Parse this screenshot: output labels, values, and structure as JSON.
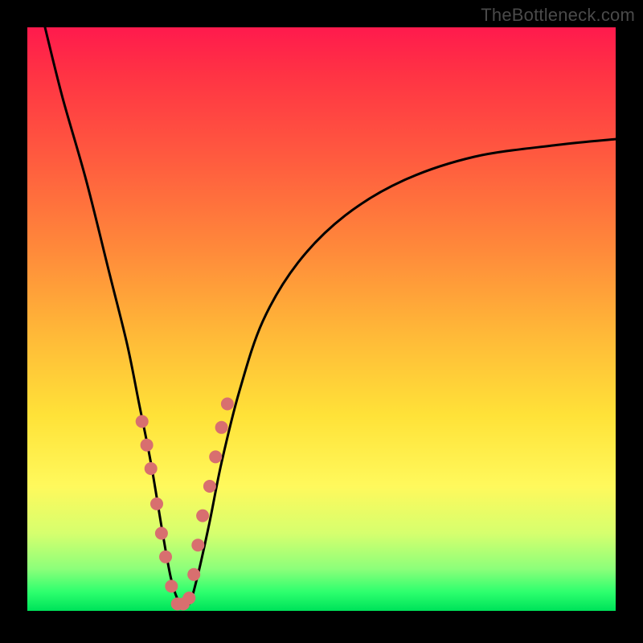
{
  "watermark_text": "TheBottleneck.com",
  "colors": {
    "frame": "#000000",
    "curve_stroke": "#000000",
    "dot_fill": "#d86f6f",
    "gradient_top": "#ff1a4d",
    "gradient_mid_orange": "#ff8a3a",
    "gradient_mid_yellow": "#ffe238",
    "gradient_green": "#00e45a"
  },
  "chart_data": {
    "type": "line",
    "title": "",
    "xlabel": "",
    "ylabel": "",
    "xlim": [
      0,
      100
    ],
    "ylim": [
      0,
      100
    ],
    "note": "Axes unlabeled; curve is a V-shaped bottleneck well. y≈100 at edges, minimum ≈0 near x≈26.",
    "series": [
      {
        "name": "bottleneck-curve",
        "x": [
          3,
          6,
          10,
          14,
          17,
          19,
          21,
          23,
          24.5,
          26,
          27.5,
          29,
          31,
          33,
          36,
          40,
          46,
          54,
          64,
          76,
          90,
          100
        ],
        "y": [
          100,
          88,
          74,
          58,
          46,
          36,
          26,
          14,
          6,
          2,
          2,
          7,
          16,
          26,
          38,
          50,
          60,
          68,
          74,
          78,
          80,
          81
        ]
      }
    ],
    "highlight_points": {
      "name": "near-minimum-dots",
      "x": [
        19.5,
        20.3,
        21.0,
        22.0,
        22.8,
        23.5,
        24.5,
        25.5,
        26.5,
        27.5,
        28.3,
        29.0,
        29.8,
        31.0,
        32.0,
        33.0,
        34.0
      ],
      "y": [
        33,
        29,
        25,
        19,
        14,
        10,
        5,
        2,
        2,
        3,
        7,
        12,
        17,
        22,
        27,
        32,
        36
      ]
    }
  }
}
